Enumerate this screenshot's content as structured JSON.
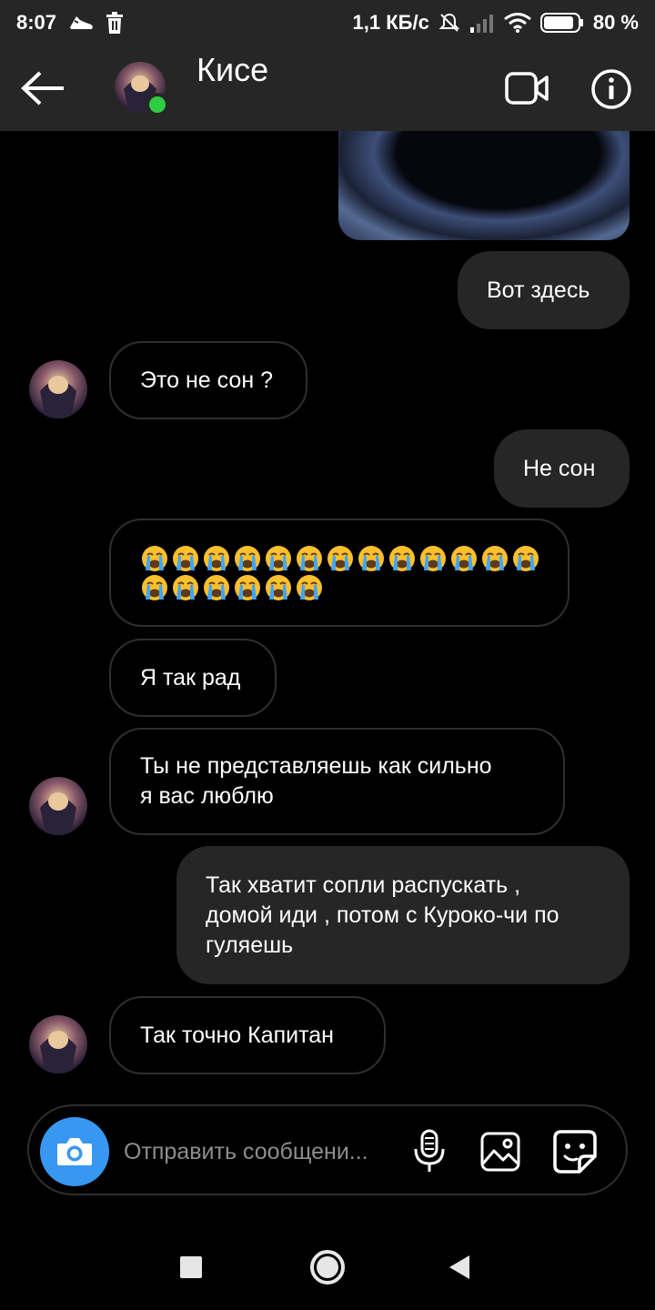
{
  "status_bar": {
    "time": "8:07",
    "network_speed": "1,1 КБ/с",
    "battery_percent": "80 %",
    "icons": [
      "shoe-icon",
      "trash-icon",
      "mute-icon",
      "signal-icon",
      "wifi-icon",
      "battery-icon"
    ]
  },
  "header": {
    "contact_name": "Кисе",
    "online": true,
    "icons": [
      "back-arrow-icon",
      "video-call-icon",
      "info-icon"
    ]
  },
  "messages": [
    {
      "side": "sent",
      "type": "image"
    },
    {
      "side": "sent",
      "type": "text",
      "lines": [
        "Вот здесь"
      ]
    },
    {
      "side": "received",
      "type": "text",
      "lines": [
        "Это не сон ?"
      ]
    },
    {
      "side": "sent",
      "type": "text",
      "lines": [
        "Не сон"
      ]
    },
    {
      "side": "received",
      "type": "emoji",
      "emoji": "😭",
      "count": 19
    },
    {
      "side": "received",
      "type": "text",
      "lines": [
        "Я так рад"
      ]
    },
    {
      "side": "received",
      "type": "text",
      "lines": [
        "Ты не представляешь как сильно",
        "я вас люблю"
      ]
    },
    {
      "side": "sent",
      "type": "text",
      "lines": [
        "Так хватит сопли распускать ,",
        "домой иди , потом с Курокo-чи по",
        "гуляешь"
      ]
    },
    {
      "side": "received",
      "type": "text",
      "lines": [
        "Так точно Капитан"
      ]
    }
  ],
  "composer": {
    "placeholder": "Отправить сообщени...",
    "icons": [
      "camera-icon",
      "microphone-icon",
      "gallery-icon",
      "sticker-icon"
    ]
  },
  "colors": {
    "background": "#000000",
    "header_bg": "#262626",
    "sent_bubble": "#262626",
    "received_border": "#2f2f2f",
    "camera_button": "#3897f0",
    "online_dot": "#2ecc40",
    "placeholder": "#8e8e8e"
  },
  "nav_bar": {
    "icons": [
      "recent-apps-icon",
      "home-icon",
      "back-icon"
    ]
  }
}
